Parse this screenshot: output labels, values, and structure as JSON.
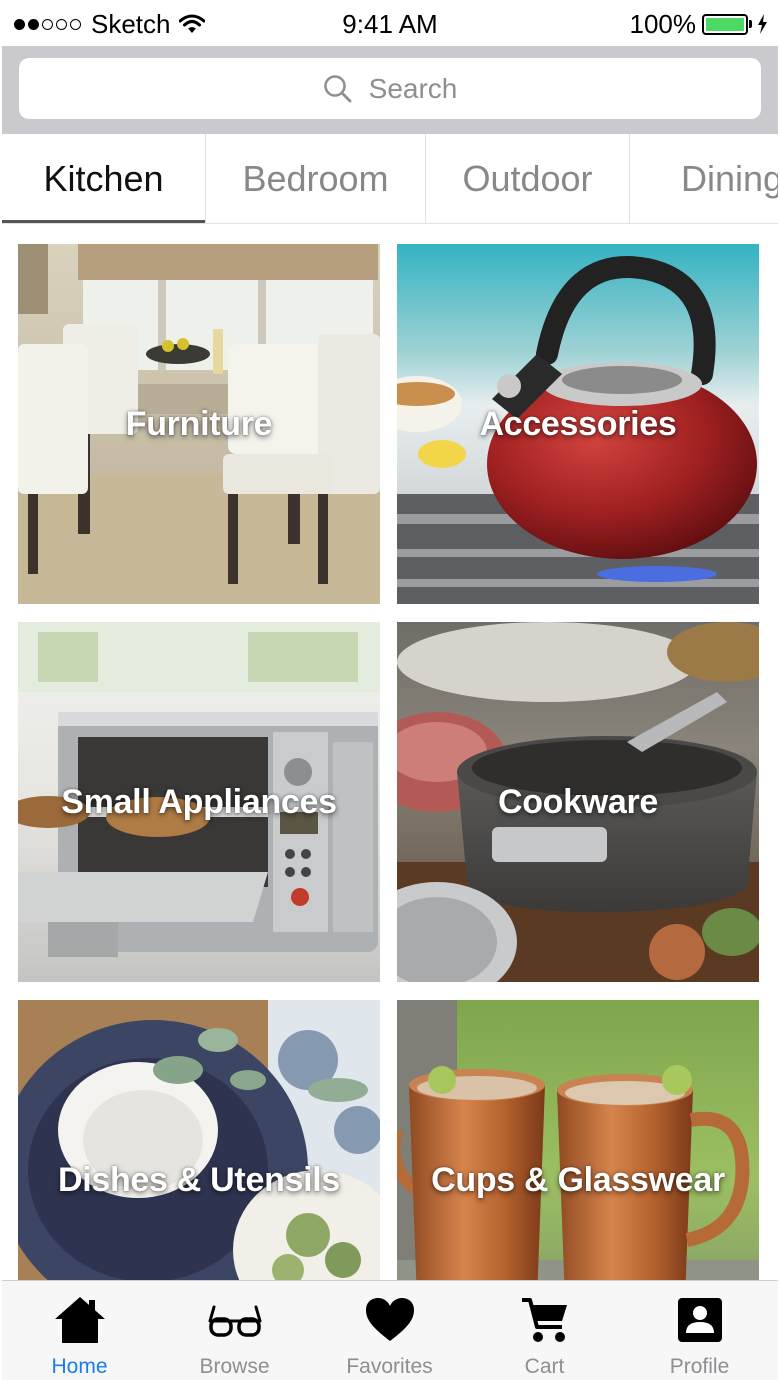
{
  "status_bar": {
    "carrier": "Sketch",
    "time": "9:41 AM",
    "battery": "100%"
  },
  "search": {
    "placeholder": "Search"
  },
  "tabs": [
    {
      "label": "Kitchen",
      "active": true
    },
    {
      "label": "Bedroom",
      "active": false
    },
    {
      "label": "Outdoor",
      "active": false
    },
    {
      "label": "Dining",
      "active": false
    }
  ],
  "categories": [
    {
      "label": "Furniture"
    },
    {
      "label": "Accessories"
    },
    {
      "label": "Small Appliances"
    },
    {
      "label": "Cookware"
    },
    {
      "label": "Dishes & Utensils"
    },
    {
      "label": "Cups & Glasswear"
    }
  ],
  "tab_bar": [
    {
      "label": "Home",
      "icon": "home-icon",
      "active": true
    },
    {
      "label": "Browse",
      "icon": "glasses-icon",
      "active": false
    },
    {
      "label": "Favorites",
      "icon": "heart-icon",
      "active": false
    },
    {
      "label": "Cart",
      "icon": "cart-icon",
      "active": false
    },
    {
      "label": "Profile",
      "icon": "profile-icon",
      "active": false
    }
  ],
  "colors": {
    "accent": "#1a7cf0",
    "battery": "#4cd964",
    "search_bar_bg": "#c9c9ce"
  }
}
